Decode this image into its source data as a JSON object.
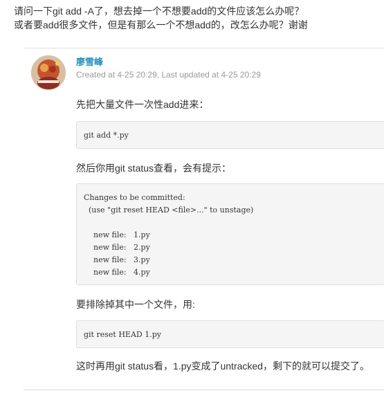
{
  "question": {
    "line1": "请问一下git add -A了，想去掉一个不想要add的文件应该怎么办呢？",
    "line2": "或者要add很多文件，但是有那么一个不想add的，改怎么办呢？谢谢"
  },
  "answer": {
    "author": "廖雪峰",
    "meta": "Created at 4-25 20:29, Last updated at 4-25 20:29",
    "paragraphs": [
      "先把大量文件一次性add进来：",
      "然后你用git status查看，会有提示：",
      "要排除掉其中一个文件，用:",
      "这时再用git status看，1.py变成了untracked，剩下的就可以提交了。"
    ],
    "code_blocks": [
      [
        "git add *.py"
      ],
      [
        "Changes to be committed:",
        "  (use \"git reset HEAD <file>...\" to unstage)",
        "",
        "    new file:   1.py",
        "    new file:   2.py",
        "    new file:   3.py",
        "    new file:   4.py"
      ],
      [
        "git reset HEAD 1.py"
      ]
    ]
  },
  "colors": {
    "author_link": "#2a8fbd",
    "meta_text": "#999999",
    "code_background": "#f5f5f5",
    "code_border": "#dedede",
    "divider": "#dddddd"
  }
}
